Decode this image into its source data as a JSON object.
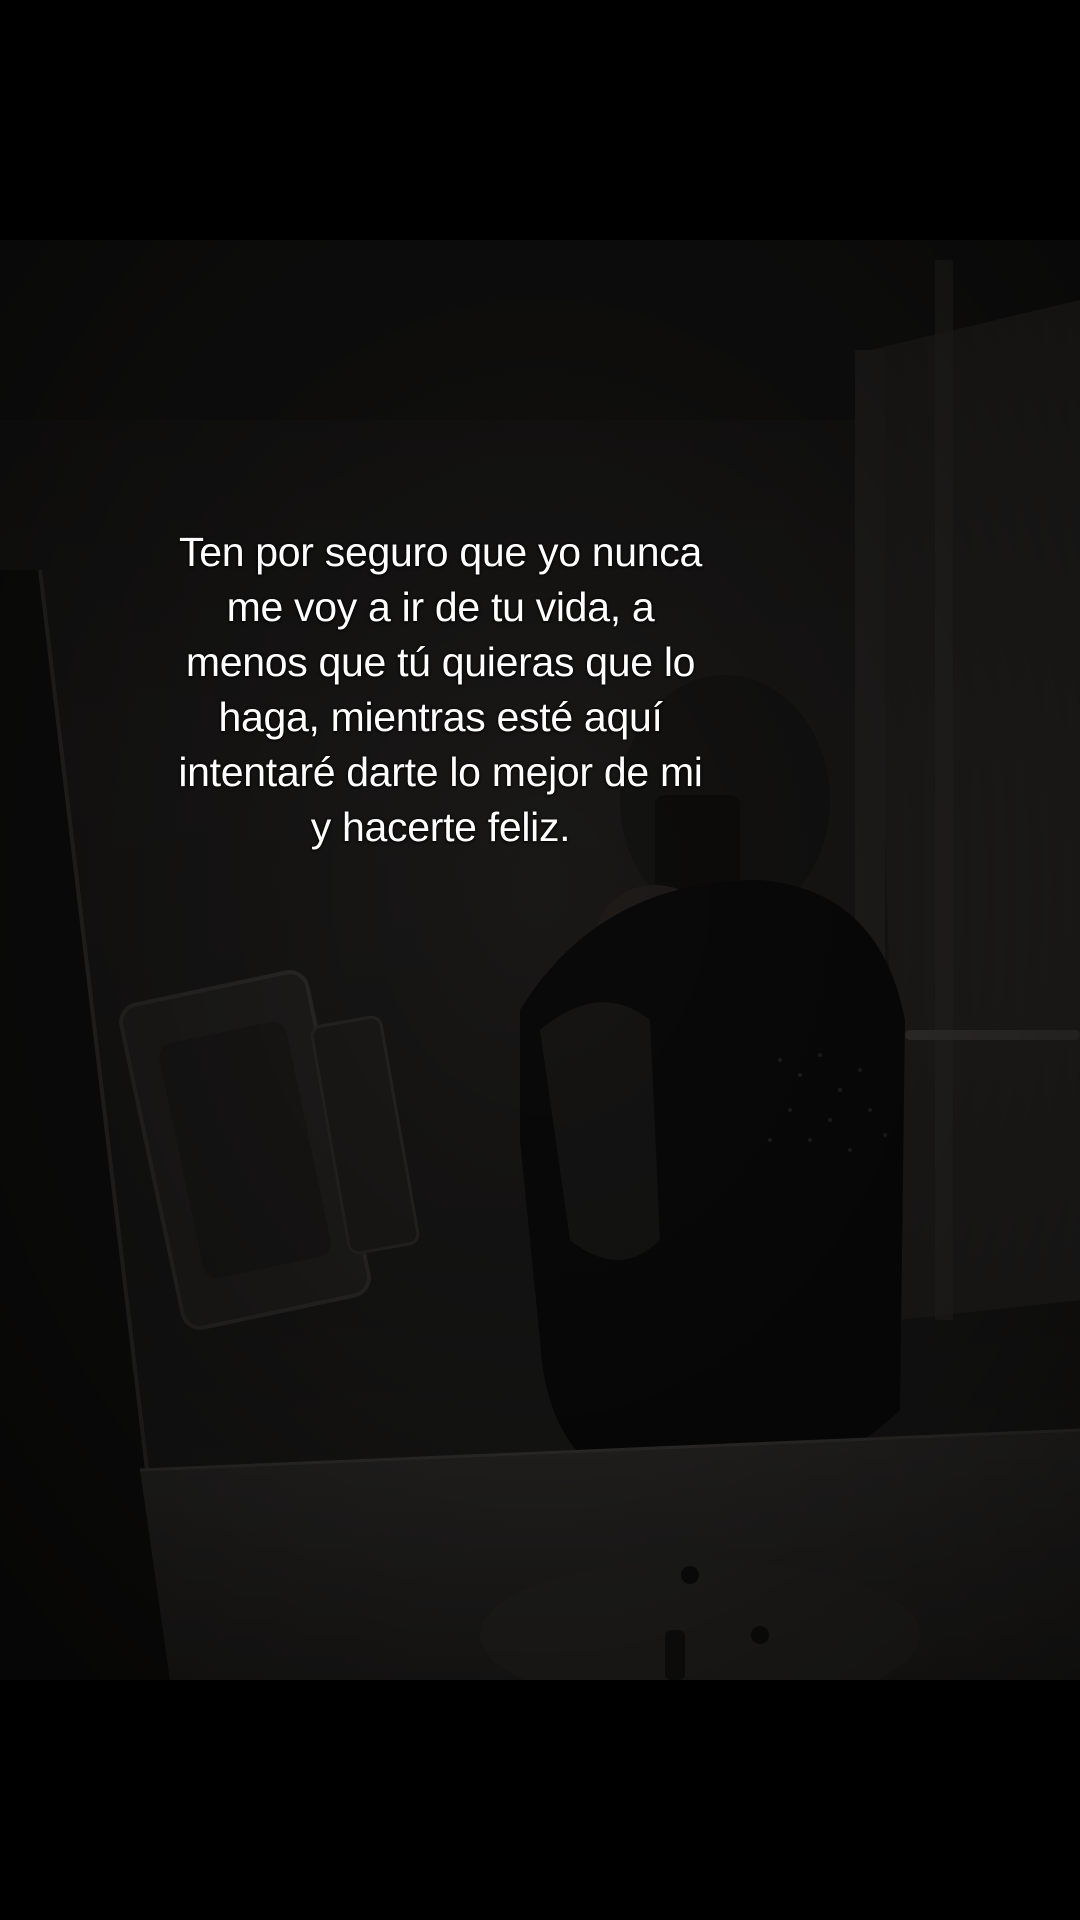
{
  "caption": {
    "lines": [
      "Ten por seguro que yo nunca",
      "me voy a ir de tu vida, a",
      "menos que tú quieras que lo",
      "haga, mientras esté aquí",
      "intentaré darte lo mejor de mi",
      "y hacerte feliz."
    ]
  },
  "colors": {
    "letterbox": "#000000",
    "photo_base": "#1f1e1d",
    "caption_text": "#ffffff"
  }
}
